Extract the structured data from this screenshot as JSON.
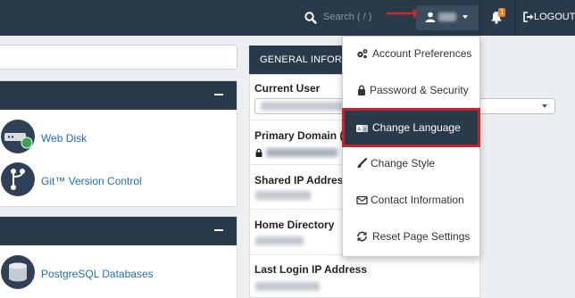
{
  "header": {
    "search_placeholder": "Search ( / )",
    "notification_count": "1",
    "logout_label": "LOGOUT"
  },
  "left": {
    "panel1_apps": [
      {
        "label": "Web Disk",
        "icon": "web-disk-icon"
      },
      {
        "label": "Git™ Version Control",
        "icon": "git-icon"
      }
    ],
    "panel2_apps": [
      {
        "label": "PostgreSQL Databases",
        "icon": "postgresql-icon"
      }
    ]
  },
  "general_info": {
    "title": "GENERAL INFORMATION",
    "fields": [
      {
        "label": "Current User"
      },
      {
        "label": "Primary Domain ("
      },
      {
        "label": "Shared IP Address"
      },
      {
        "label": "Home Directory"
      },
      {
        "label": "Last Login IP Address"
      }
    ]
  },
  "user_menu": {
    "items": [
      {
        "label": "Account Preferences",
        "icon": "gears-icon"
      },
      {
        "label": "Password & Security",
        "icon": "lock-icon"
      },
      {
        "label": "Change Language",
        "icon": "language-icon",
        "active": true
      },
      {
        "label": "Change Style",
        "icon": "paintbrush-icon"
      },
      {
        "label": "Contact Information",
        "icon": "envelope-icon"
      },
      {
        "label": "Reset Page Settings",
        "icon": "refresh-icon"
      }
    ]
  },
  "colors": {
    "topbar": "#293a4a",
    "highlight_border": "#c9202a",
    "arrow": "#d9232b",
    "badge": "#e67e22",
    "link": "#1f6fb5"
  }
}
